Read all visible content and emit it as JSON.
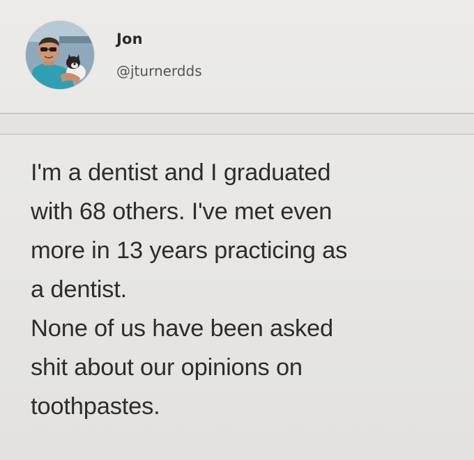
{
  "post": {
    "author_name": "Jon",
    "author_handle": "@jturnerdds",
    "text_lines": [
      "I'm a dentist and I graduated",
      "with 68 others. I've met even",
      "more in 13 years practicing as",
      "a dentist.",
      "None of us have been asked",
      "shit about our opinions on",
      "toothpastes."
    ]
  },
  "colors": {
    "background": "#e9e8e4",
    "text": "#2d2d2d",
    "handle": "#555555",
    "avatar_shirt": "#2f9fb4"
  },
  "icons": {
    "avatar": "profile-photo"
  }
}
